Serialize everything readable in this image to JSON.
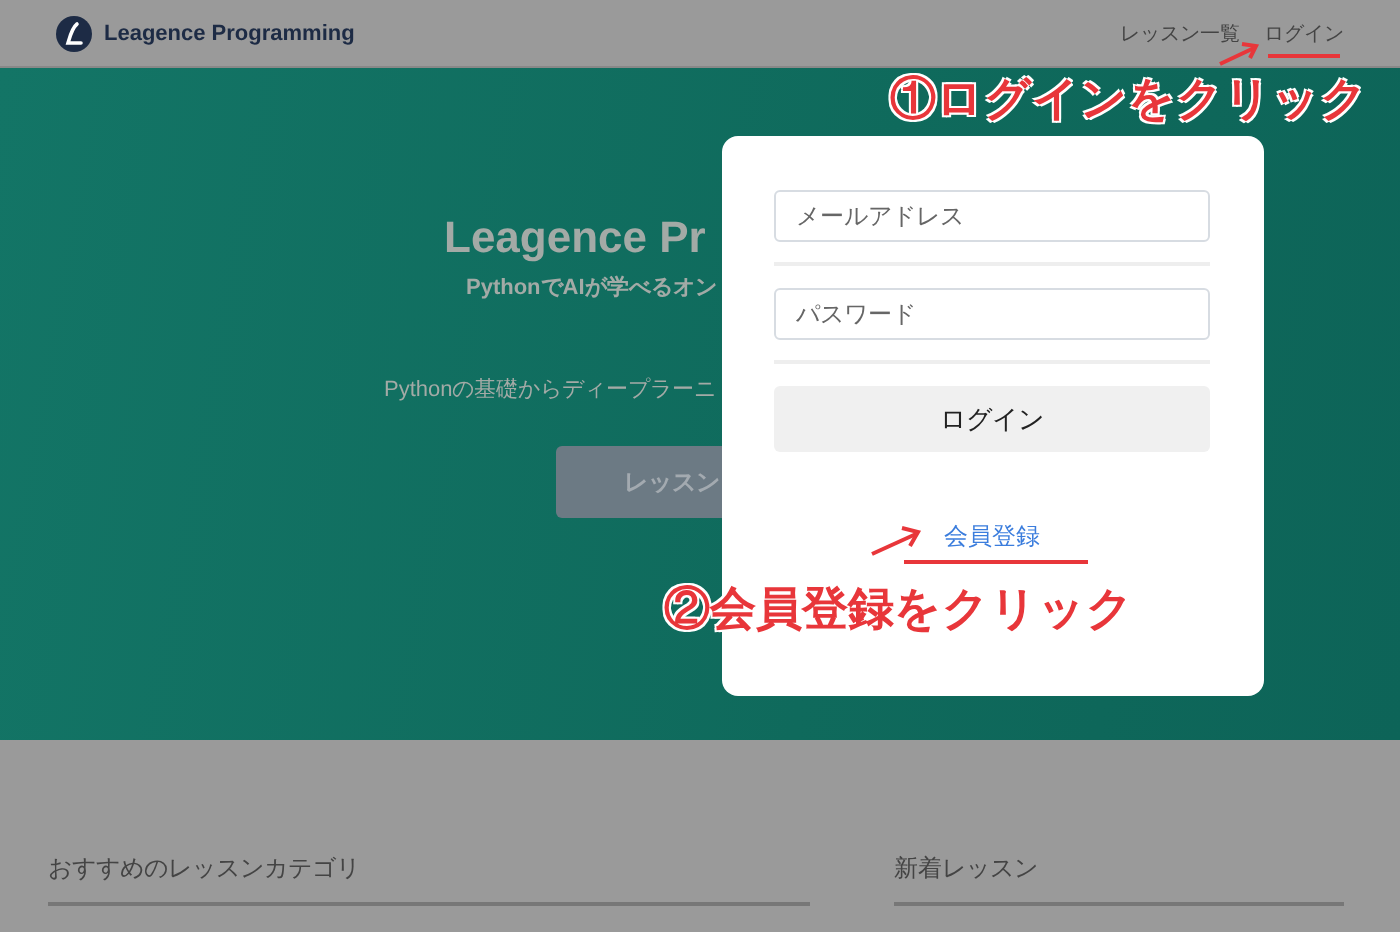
{
  "header": {
    "logo": "Leagence Programming",
    "nav": [
      {
        "label": "レッスン一覧"
      },
      {
        "label": "ログイン"
      }
    ]
  },
  "hero": {
    "title": "Leagence Pr",
    "subtitle": "PythonでAIが学べるオン",
    "description": "Pythonの基礎からディープラーニ",
    "button": "レッスン"
  },
  "login_dialog": {
    "email": {
      "placeholder": "メールアドレス"
    },
    "password": {
      "placeholder": "パスワード"
    },
    "submit": "ログイン",
    "register_link": "会員登録"
  },
  "sections": [
    {
      "heading": "おすすめのレッスンカテゴリ"
    },
    {
      "heading": "新着レッスン"
    }
  ],
  "annotations": [
    {
      "text": "①ログインをクリック"
    },
    {
      "text": "②会員登録をクリック"
    }
  ]
}
